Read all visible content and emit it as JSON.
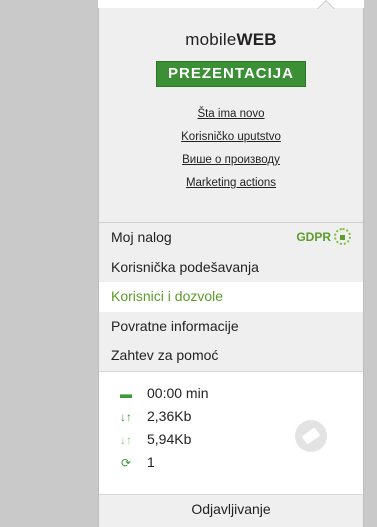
{
  "header": {
    "logo_plain": "mobile",
    "logo_bold": "WEB",
    "presentation_label": "PREZENTACIJA"
  },
  "links": [
    "Šta ima novo",
    "Korisničko uputstvo",
    "Више о производу",
    "Marketing actions"
  ],
  "menu": {
    "account": "Moj nalog",
    "gdpr": "GDPR",
    "user_settings": "Korisnička podešavanja",
    "users_permissions": "Korisnici i dozvole",
    "feedback": "Povratne informacije",
    "help": "Zahtev za pomoć"
  },
  "stats": {
    "time": "00:00 min",
    "download": "2,36Kb",
    "upload": "5,94Kb",
    "sync_count": "1"
  },
  "footer": {
    "logout": "Odjavljivanje"
  },
  "colors": {
    "accent_green": "#3b8f35",
    "active_text": "#5b9c2a",
    "backdrop": "#c9c9c9"
  }
}
